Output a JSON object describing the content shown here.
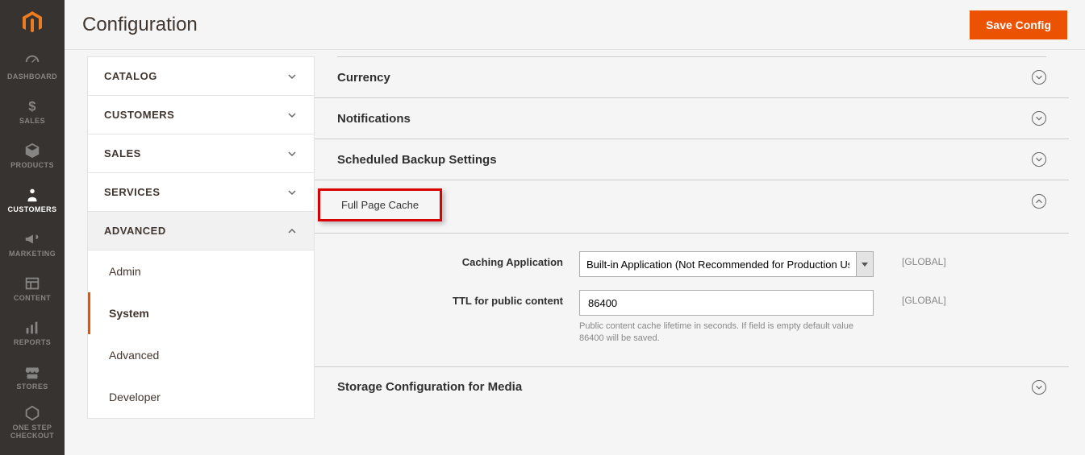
{
  "page_title": "Configuration",
  "save_button": "Save Config",
  "leftnav": [
    {
      "id": "dashboard",
      "label": "DASHBOARD",
      "active": false
    },
    {
      "id": "sales",
      "label": "SALES",
      "active": false
    },
    {
      "id": "products",
      "label": "PRODUCTS",
      "active": false
    },
    {
      "id": "customers",
      "label": "CUSTOMERS",
      "active": true
    },
    {
      "id": "marketing",
      "label": "MARKETING",
      "active": false
    },
    {
      "id": "content",
      "label": "CONTENT",
      "active": false
    },
    {
      "id": "reports",
      "label": "REPORTS",
      "active": false
    },
    {
      "id": "stores",
      "label": "STORES",
      "active": false
    },
    {
      "id": "onestep",
      "label": "ONE STEP\nCHECKOUT",
      "active": false
    }
  ],
  "config_tree": {
    "groups": [
      {
        "label": "CATALOG",
        "expanded": false
      },
      {
        "label": "CUSTOMERS",
        "expanded": false
      },
      {
        "label": "SALES",
        "expanded": false
      },
      {
        "label": "SERVICES",
        "expanded": false
      },
      {
        "label": "ADVANCED",
        "expanded": true,
        "items": [
          {
            "label": "Admin",
            "active": false
          },
          {
            "label": "System",
            "active": true
          },
          {
            "label": "Advanced",
            "active": false
          },
          {
            "label": "Developer",
            "active": false
          }
        ]
      }
    ]
  },
  "sections": {
    "currency": {
      "title": "Currency",
      "open": false
    },
    "notifications": {
      "title": "Notifications",
      "open": false
    },
    "scheduled_backup": {
      "title": "Scheduled Backup Settings",
      "open": false
    },
    "full_page_cache": {
      "title": "Full Page Cache",
      "open": true
    },
    "storage": {
      "title": "Storage Configuration for Media",
      "open": false
    }
  },
  "full_page_cache_fields": {
    "caching_application": {
      "label": "Caching Application",
      "value": "Built-in Application (Not Recommended for Production Use)",
      "scope": "[GLOBAL]"
    },
    "ttl": {
      "label": "TTL for public content",
      "value": "86400",
      "hint": "Public content cache lifetime in seconds. If field is empty default value 86400 will be saved.",
      "scope": "[GLOBAL]"
    }
  }
}
